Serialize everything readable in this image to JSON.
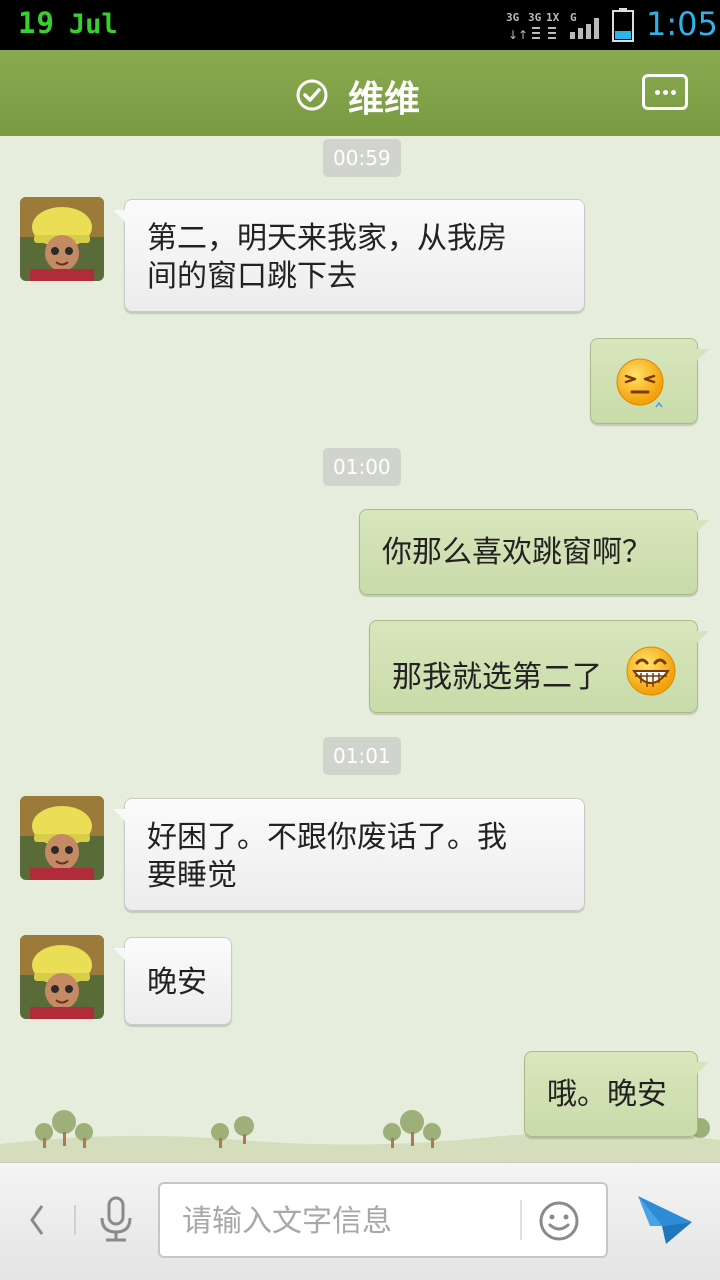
{
  "status_bar": {
    "date_day": "19",
    "date_month": "Jul",
    "network_labels": [
      "3G",
      "3G",
      "1X",
      "G"
    ],
    "time": "1:05",
    "battery_level": 0.3,
    "time_color": "#2fb2e8",
    "date_color": "#36d12e"
  },
  "header": {
    "title": "维维",
    "status_icon": "online-check-icon",
    "menu_icon": "more-dots-icon",
    "background": "#7a9a42"
  },
  "messages": [
    {
      "type": "timestamp",
      "text": "00:59"
    },
    {
      "type": "incoming",
      "lines": [
        "第二，明天来我家，从我房",
        "间的窗口跳下去"
      ]
    },
    {
      "type": "outgoing",
      "emoji": "squint-annoyed-face"
    },
    {
      "type": "timestamp",
      "text": "01:00"
    },
    {
      "type": "outgoing",
      "lines": [
        "你那么喜欢跳窗啊？"
      ]
    },
    {
      "type": "outgoing",
      "lines": [
        "那我就选第二了"
      ],
      "emoji": "big-grin-face"
    },
    {
      "type": "timestamp",
      "text": "01:01"
    },
    {
      "type": "incoming",
      "lines": [
        "好困了。不跟你废话了。我",
        "要睡觉"
      ]
    },
    {
      "type": "incoming",
      "lines": [
        "晚安"
      ]
    },
    {
      "type": "outgoing",
      "lines": [
        "哦。晚安"
      ]
    }
  ],
  "input_bar": {
    "placeholder": "请输入文字信息",
    "back_icon": "chevron-left-icon",
    "voice_icon": "microphone-icon",
    "emoji_icon": "smiley-icon",
    "send_icon": "paper-plane-send-icon"
  },
  "colors": {
    "outgoing_bubble": "#cfe0b2",
    "incoming_bubble": "#f5f5f5",
    "chat_background": "#e6eddc",
    "send_accent": "#2e8bd6"
  }
}
